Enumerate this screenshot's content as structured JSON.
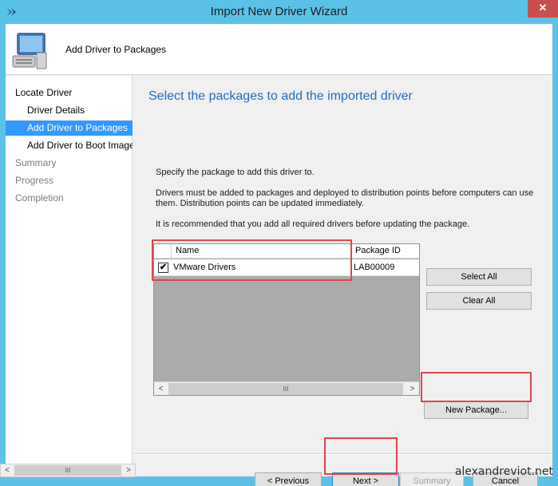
{
  "window": {
    "title": "Import New Driver Wizard",
    "close_label": "✕"
  },
  "header": {
    "title": "Add Driver to Packages"
  },
  "nav": {
    "items": [
      {
        "label": "Locate Driver",
        "state": "done"
      },
      {
        "label": "Driver Details",
        "state": "done"
      },
      {
        "label": "Add Driver to Packages",
        "state": "active"
      },
      {
        "label": "Add Driver to Boot Images",
        "state": "done"
      },
      {
        "label": "Summary",
        "state": "pending"
      },
      {
        "label": "Progress",
        "state": "pending"
      },
      {
        "label": "Completion",
        "state": "pending"
      }
    ]
  },
  "content": {
    "heading": "Select the packages to add the imported driver",
    "instruction": "Specify the package to add this driver to.",
    "note1": "Drivers must be added to packages and deployed to distribution points before computers can use them.  Distribution points can be updated immediately.",
    "note2": "It is recommended that you add all required drivers before updating the package."
  },
  "grid": {
    "columns": [
      "Name",
      "Package ID"
    ],
    "rows": [
      {
        "checked": true,
        "check_glyph": "✔",
        "name": "VMware Drivers",
        "package_id": "LAB00009"
      }
    ],
    "scroll_left": "<",
    "scroll_right": ">",
    "scroll_grip": "III"
  },
  "buttons": {
    "select_all": "Select All",
    "clear_all": "Clear All",
    "new_package": "New Package...",
    "previous": "< Previous",
    "next": "Next >",
    "summary": "Summary",
    "cancel": "Cancel"
  },
  "bottom_scrollbar": {
    "left": "<",
    "right": ">",
    "grip": "III"
  },
  "watermark": "alexandreviot.net",
  "colors": {
    "title_bar": "#5bc2e7",
    "selection": "#3399ff",
    "heading": "#1f6ec0",
    "highlight": "#e0464a"
  }
}
